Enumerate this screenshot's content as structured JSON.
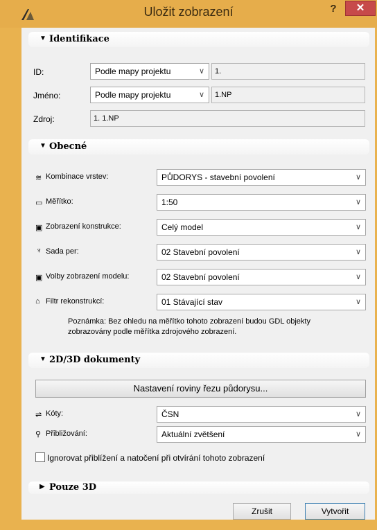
{
  "window": {
    "title": "Uložit zobrazení",
    "help": "?",
    "close": "✕"
  },
  "sections": {
    "identifikace": "Identifikace",
    "obecne": "Obecné",
    "dokumenty": "2D/3D dokumenty",
    "pouze3d": "Pouze 3D"
  },
  "identifikace": {
    "id_label": "ID:",
    "id_select": "Podle mapy projektu",
    "id_value": "1.",
    "jmeno_label": "Jméno:",
    "jmeno_select": "Podle mapy projektu",
    "jmeno_value": "1.NP",
    "zdroj_label": "Zdroj:",
    "zdroj_value": "1. 1.NP"
  },
  "obecne": {
    "kombinace_label": "Kombinace vrstev:",
    "kombinace_value": "PŮDORYS - stavební povolení",
    "meritko_label": "Měřítko:",
    "meritko_value": "1:50",
    "zobrazeni_label": "Zobrazení konstrukce:",
    "zobrazeni_value": "Celý model",
    "sada_label": "Sada per:",
    "sada_value": "02 Stavební povolení",
    "volby_label": "Volby zobrazení modelu:",
    "volby_value": "02 Stavební povolení",
    "filtr_label": "Filtr rekonstrukcí:",
    "filtr_value": "01 Stávající stav",
    "note_line1": "Poznámka: Bez ohledu na měřítko tohoto zobrazení budou GDL objekty",
    "note_line2": "zobrazovány podle měřítka zdrojového zobrazení."
  },
  "dokumenty": {
    "nastaveni_button": "Nastavení roviny řezu půdorysu...",
    "koty_label": "Kóty:",
    "koty_value": "ČSN",
    "priblizovani_label": "Přibližování:",
    "priblizovani_value": "Aktuální zvětšení",
    "ignore_checkbox_label": "Ignorovat přiblížení a natočení při otvírání tohoto zobrazení"
  },
  "buttons": {
    "cancel": "Zrušit",
    "create": "Vytvořit"
  },
  "icons": {
    "layers": "layers-icon",
    "scale": "scale-icon",
    "structure": "structure-icon",
    "pen": "pen-icon",
    "model": "model-icon",
    "filter": "filter-icon",
    "dimension": "dimension-icon",
    "zoom": "zoom-icon"
  },
  "colors": {
    "titlebar": "#e6ad4b",
    "close": "#c74a4a",
    "client": "#f0f0f0"
  }
}
